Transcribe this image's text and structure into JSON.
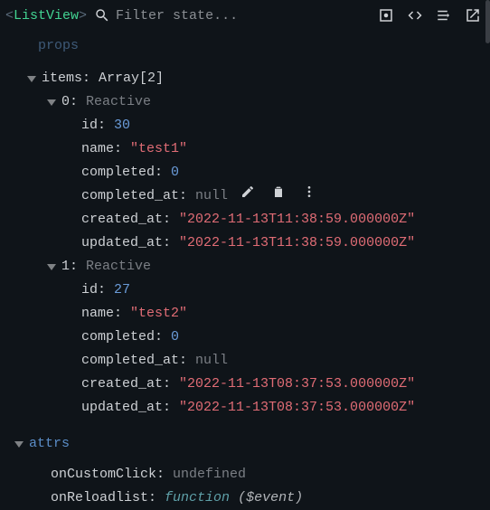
{
  "header": {
    "component_name": "ListView",
    "filter_placeholder": "Filter state..."
  },
  "prev_section": "props",
  "items_label": "items",
  "items_type": "Array[2]",
  "items": [
    {
      "index": "0",
      "type": "Reactive",
      "fields": {
        "id": 30,
        "name": "\"test1\"",
        "completed": 0,
        "completed_at": "null",
        "created_at": "\"2022-11-13T11:38:59.000000Z\"",
        "updated_at": "\"2022-11-13T11:38:59.000000Z\""
      }
    },
    {
      "index": "1",
      "type": "Reactive",
      "fields": {
        "id": 27,
        "name": "\"test2\"",
        "completed": 0,
        "completed_at": "null",
        "created_at": "\"2022-11-13T08:37:53.000000Z\"",
        "updated_at": "\"2022-11-13T08:37:53.000000Z\""
      }
    }
  ],
  "attrs_label": "attrs",
  "attrs": {
    "onCustomClick": "undefined",
    "onReloadlist_func": "function",
    "onReloadlist_args": "($event)"
  }
}
